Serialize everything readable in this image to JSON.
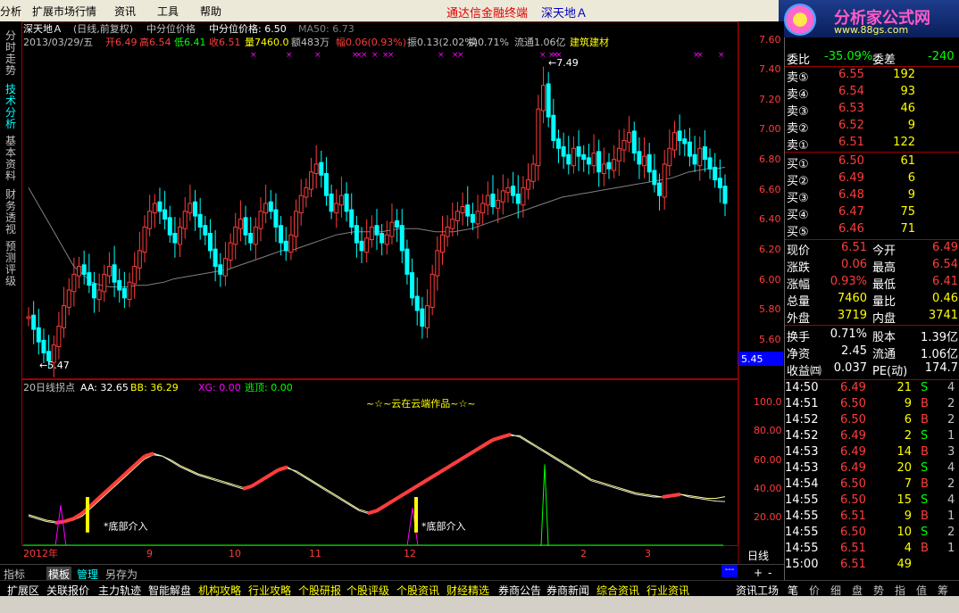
{
  "menu": {
    "items": [
      "分析",
      "扩展市场行情",
      "资讯",
      "工具",
      "帮助"
    ],
    "brand": "通达信金融终端",
    "stock_name": "深天地Ａ"
  },
  "logo": {
    "title": "分析家公式网",
    "url": "www.88gs.com"
  },
  "left_tabs": [
    {
      "label": "分时走势",
      "active": false
    },
    {
      "label": "技术分析",
      "active": true
    },
    {
      "label": "基本资料",
      "active": false
    },
    {
      "label": "财务透视",
      "active": false
    },
    {
      "label": "预测评级",
      "active": false
    }
  ],
  "header": {
    "line1_name": "深天地Ａ",
    "line1_mode": "(日线,前复权)",
    "line1_mid": "中分位价格",
    "line1_mid2": "中分位价格: 6.50",
    "line1_ma": "MA50: 6.73",
    "line2_date": "2013/03/29/五",
    "line2_open": "开6.49",
    "line2_high": "高6.54",
    "line2_low": "低6.41",
    "line2_close": "收6.51",
    "line2_vol": "量7460.0",
    "line2_amt": "额483万",
    "line2_chg": "幅0.06(0.93%)",
    "line2_amp": "振0.13(2.02%)",
    "line2_turn": "换0.71%",
    "line2_float": "流通1.06亿",
    "line2_sector": "建筑建材"
  },
  "price_axis": [
    "7.60",
    "7.40",
    "7.20",
    "7.00",
    "6.80",
    "6.60",
    "6.40",
    "6.20",
    "6.00",
    "5.80",
    "5.60"
  ],
  "price_current": "5.45",
  "price_annotations": {
    "high": "7.49",
    "low": "5.47"
  },
  "indicator": {
    "name": "20日线拐点",
    "aa": "AA: 32.65",
    "bb": "BB: 36.29",
    "xg": "XG: 0.00",
    "tp": "逃顶: 0.00",
    "credit": "~☆~云在云端作品~☆~",
    "signal_label": "*底部介入",
    "axis": [
      "100.0",
      "80.00",
      "60.00",
      "40.00",
      "20.00"
    ]
  },
  "time_axis": [
    "2012年",
    "9",
    "10",
    "11",
    "12",
    "2",
    "3"
  ],
  "period_label": "日线",
  "bottom_tabs": [
    {
      "label": "指标",
      "on": false
    },
    {
      "label": "模板",
      "on": true
    },
    {
      "label": "管理",
      "on": false
    },
    {
      "label": "另存为",
      "on": false
    }
  ],
  "nav_items": [
    "扩展区",
    "关联报价",
    "主力轨迹",
    "智能解盘",
    "机构攻略",
    "行业攻略",
    "个股研报",
    "个股评级",
    "个股资讯",
    "财经精选",
    "券商公告",
    "券商新闻",
    "综合资讯",
    "行业资讯"
  ],
  "right_panel": {
    "wb_label": "委比",
    "wb_value": "-35.09%",
    "wc_label": "委差",
    "wc_value": "-240",
    "sells": [
      {
        "label": "卖⑤",
        "price": "6.55",
        "vol": "192"
      },
      {
        "label": "卖④",
        "price": "6.54",
        "vol": "93"
      },
      {
        "label": "卖③",
        "price": "6.53",
        "vol": "46"
      },
      {
        "label": "卖②",
        "price": "6.52",
        "vol": "9"
      },
      {
        "label": "卖①",
        "price": "6.51",
        "vol": "122"
      }
    ],
    "buys": [
      {
        "label": "买①",
        "price": "6.50",
        "vol": "61"
      },
      {
        "label": "买②",
        "price": "6.49",
        "vol": "6"
      },
      {
        "label": "买③",
        "price": "6.48",
        "vol": "9"
      },
      {
        "label": "买④",
        "price": "6.47",
        "vol": "75"
      },
      {
        "label": "买⑤",
        "price": "6.46",
        "vol": "71"
      }
    ],
    "stats": [
      {
        "l1": "现价",
        "v1": "6.51",
        "l2": "今开",
        "v2": "6.49"
      },
      {
        "l1": "涨跌",
        "v1": "0.06",
        "l2": "最高",
        "v2": "6.54"
      },
      {
        "l1": "涨幅",
        "v1": "0.93%",
        "l2": "最低",
        "v2": "6.41"
      },
      {
        "l1": "总量",
        "v1": "7460",
        "l2": "量比",
        "v2": "0.46"
      },
      {
        "l1": "外盘",
        "v1": "3719",
        "l2": "内盘",
        "v2": "3741"
      }
    ],
    "stats2": [
      {
        "l1": "换手",
        "v1": "0.71%",
        "l2": "股本",
        "v2": "1.39亿"
      },
      {
        "l1": "净资",
        "v1": "2.45",
        "l2": "流通",
        "v2": "1.06亿"
      },
      {
        "l1": "收益㈣",
        "v1": "0.037",
        "l2": "PE(动)",
        "v2": "174.7"
      }
    ],
    "ticks": [
      {
        "t": "14:50",
        "p": "6.49",
        "v": "21",
        "d": "S",
        "n": "4"
      },
      {
        "t": "14:51",
        "p": "6.50",
        "v": "9",
        "d": "B",
        "n": "2"
      },
      {
        "t": "14:52",
        "p": "6.50",
        "v": "6",
        "d": "B",
        "n": "2"
      },
      {
        "t": "14:52",
        "p": "6.49",
        "v": "2",
        "d": "S",
        "n": "1"
      },
      {
        "t": "14:53",
        "p": "6.49",
        "v": "14",
        "d": "B",
        "n": "3"
      },
      {
        "t": "14:53",
        "p": "6.49",
        "v": "20",
        "d": "S",
        "n": "4"
      },
      {
        "t": "14:54",
        "p": "6.50",
        "v": "7",
        "d": "B",
        "n": "2"
      },
      {
        "t": "14:55",
        "p": "6.50",
        "v": "15",
        "d": "S",
        "n": "4"
      },
      {
        "t": "14:55",
        "p": "6.51",
        "v": "9",
        "d": "B",
        "n": "1"
      },
      {
        "t": "14:55",
        "p": "6.50",
        "v": "10",
        "d": "S",
        "n": "2"
      },
      {
        "t": "14:55",
        "p": "6.51",
        "v": "4",
        "d": "B",
        "n": "1"
      },
      {
        "t": "15:00",
        "p": "6.51",
        "v": "49",
        "d": "",
        "n": ""
      }
    ],
    "tabs": [
      "笔",
      "价",
      "细",
      "盘",
      "势",
      "指",
      "值",
      "筹"
    ],
    "tool": "资讯工场"
  },
  "colors": {
    "up": "#ff3c3c",
    "down": "#00ffff",
    "white": "#ffffff",
    "yellow": "#ffff00",
    "green": "#00ff00",
    "magenta": "#ff00ff",
    "grey": "#808080"
  },
  "chart_data": {
    "type": "candlestick",
    "ylim": [
      5.4,
      7.6
    ],
    "price_series": [
      5.78,
      5.7,
      5.62,
      5.55,
      5.5,
      5.6,
      5.72,
      5.85,
      5.95,
      6.05,
      6.1,
      6.05,
      5.98,
      5.9,
      5.95,
      6.05,
      6.1,
      6.0,
      5.95,
      5.9,
      6.0,
      6.1,
      6.2,
      6.35,
      6.45,
      6.5,
      6.45,
      6.4,
      6.3,
      6.25,
      6.35,
      6.45,
      6.5,
      6.42,
      6.35,
      6.3,
      6.2,
      6.1,
      6.05,
      6.15,
      6.25,
      6.35,
      6.4,
      6.3,
      6.25,
      6.35,
      6.45,
      6.5,
      6.45,
      6.35,
      6.25,
      6.2,
      6.3,
      6.45,
      6.55,
      6.6,
      6.7,
      6.75,
      6.68,
      6.55,
      6.45,
      6.5,
      6.55,
      6.45,
      6.35,
      6.25,
      6.2,
      6.28,
      6.35,
      6.3,
      6.25,
      6.3,
      6.38,
      6.35,
      6.2,
      6.05,
      5.9,
      5.82,
      5.72,
      5.85,
      6.05,
      6.2,
      6.3,
      6.35,
      6.4,
      6.45,
      6.48,
      6.42,
      6.38,
      6.45,
      6.5,
      6.55,
      6.48,
      6.52,
      6.58,
      6.6,
      6.55,
      6.5,
      6.6,
      6.65,
      6.75,
      7.1,
      7.25,
      7.05,
      6.9,
      6.85,
      6.8,
      6.75,
      6.85,
      6.8,
      6.78,
      6.75,
      6.82,
      6.7,
      6.75,
      6.72,
      6.78,
      6.85,
      6.9,
      6.95,
      6.82,
      6.75,
      6.8,
      6.7,
      6.62,
      6.55,
      6.75,
      6.85,
      6.95,
      6.9,
      6.88,
      6.8,
      6.75,
      6.85,
      6.78,
      6.72,
      6.65,
      6.6,
      6.5
    ],
    "ma_series": [
      6.6,
      6.5,
      6.4,
      6.3,
      6.2,
      6.1,
      6.05,
      6.0,
      5.98,
      5.97,
      5.97,
      5.97,
      5.98,
      5.98,
      5.99,
      6.0,
      6.02,
      6.03,
      6.04,
      6.05,
      6.06,
      6.07,
      6.08,
      6.1,
      6.12,
      6.14,
      6.16,
      6.18,
      6.2,
      6.2,
      6.22,
      6.24,
      6.26,
      6.28,
      6.3,
      6.31,
      6.32,
      6.32,
      6.32,
      6.32,
      6.33,
      6.34,
      6.34,
      6.34,
      6.33,
      6.32,
      6.32,
      6.32,
      6.33,
      6.34,
      6.36,
      6.38,
      6.4,
      6.42,
      6.44,
      6.46,
      6.48,
      6.5,
      6.52,
      6.54,
      6.55,
      6.56,
      6.57,
      6.58,
      6.59,
      6.6,
      6.61,
      6.62,
      6.63,
      6.64,
      6.65,
      6.66,
      6.68,
      6.7,
      6.71,
      6.72,
      6.72,
      6.73
    ],
    "aa_series": [
      22,
      20,
      18,
      17,
      18,
      20,
      24,
      30,
      36,
      42,
      48,
      54,
      60,
      66,
      68,
      66,
      62,
      58,
      55,
      52,
      50,
      48,
      46,
      44,
      42,
      44,
      48,
      52,
      56,
      58,
      54,
      50,
      46,
      42,
      38,
      34,
      30,
      26,
      24,
      26,
      30,
      34,
      38,
      42,
      46,
      50,
      54,
      58,
      62,
      66,
      70,
      74,
      78,
      80,
      82,
      80,
      76,
      72,
      68,
      64,
      60,
      56,
      52,
      48,
      46,
      44,
      42,
      40,
      38,
      37,
      36,
      36,
      37,
      38,
      36,
      35,
      34,
      33,
      32.65
    ],
    "bb_series": [
      23,
      21,
      19,
      18,
      18,
      19,
      22,
      28,
      34,
      40,
      46,
      52,
      58,
      64,
      67,
      66,
      63,
      59,
      56,
      53,
      51,
      49,
      47,
      45,
      43,
      44,
      47,
      51,
      55,
      57,
      55,
      51,
      47,
      43,
      39,
      35,
      31,
      27,
      25,
      25,
      29,
      33,
      37,
      41,
      45,
      49,
      53,
      57,
      61,
      65,
      69,
      73,
      77,
      79,
      81,
      81,
      77,
      73,
      69,
      65,
      61,
      57,
      53,
      49,
      47,
      45,
      43,
      41,
      39,
      38,
      37,
      36,
      37,
      38,
      37,
      36,
      35,
      35,
      36.29
    ]
  }
}
